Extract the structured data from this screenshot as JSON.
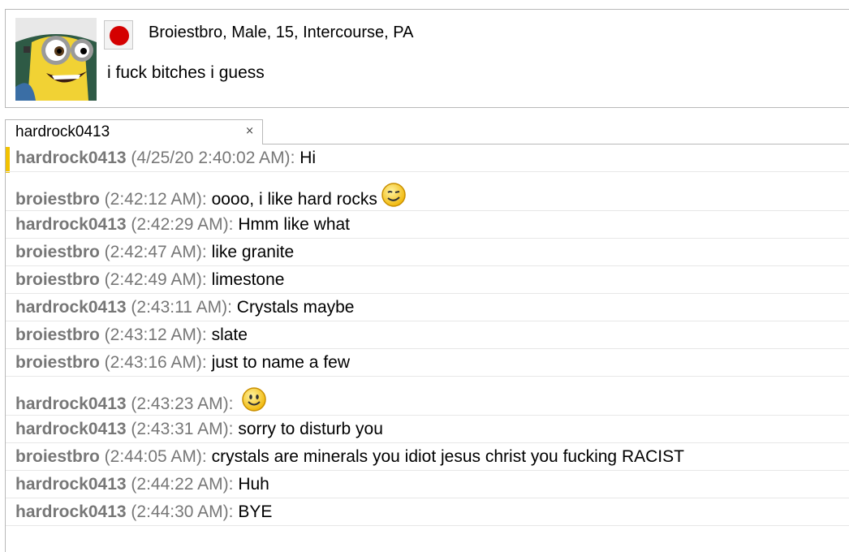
{
  "profile": {
    "info": "Broiestbro, Male, 15, Intercourse, PA",
    "status": "i fuck bitches i guess",
    "flag_color": "#d40000"
  },
  "tab": {
    "label": "hardrock0413",
    "close": "×"
  },
  "messages": [
    {
      "user": "hardrock0413",
      "time": "(4/25/20 2:40:02 AM)",
      "text": "Hi",
      "emoji": ""
    },
    {
      "user": "broiestbro",
      "time": "(2:42:12 AM)",
      "text": "oooo, i like hard rocks",
      "emoji": "wink-emoji"
    },
    {
      "user": "hardrock0413",
      "time": "(2:42:29 AM)",
      "text": "Hmm like what",
      "emoji": ""
    },
    {
      "user": "broiestbro",
      "time": "(2:42:47 AM)",
      "text": "like granite",
      "emoji": ""
    },
    {
      "user": "broiestbro",
      "time": "(2:42:49 AM)",
      "text": "limestone",
      "emoji": ""
    },
    {
      "user": "hardrock0413",
      "time": "(2:43:11 AM)",
      "text": "Crystals maybe",
      "emoji": ""
    },
    {
      "user": "broiestbro",
      "time": "(2:43:12 AM)",
      "text": "slate",
      "emoji": ""
    },
    {
      "user": "broiestbro",
      "time": "(2:43:16 AM)",
      "text": "just to name a few",
      "emoji": ""
    },
    {
      "user": "hardrock0413",
      "time": "(2:43:23 AM)",
      "text": "",
      "emoji": "smile-emoji"
    },
    {
      "user": "hardrock0413",
      "time": "(2:43:31 AM)",
      "text": "sorry to disturb you",
      "emoji": ""
    },
    {
      "user": "broiestbro",
      "time": "(2:44:05 AM)",
      "text": "crystals are minerals you idiot jesus christ you fucking RACIST",
      "emoji": ""
    },
    {
      "user": "hardrock0413",
      "time": "(2:44:22 AM)",
      "text": "Huh",
      "emoji": ""
    },
    {
      "user": "hardrock0413",
      "time": "(2:44:30 AM)",
      "text": "BYE",
      "emoji": ""
    }
  ],
  "colors": {
    "username": "#777777",
    "unread_indicator": "#f2c200",
    "emoji_fill": "#f5c400"
  }
}
